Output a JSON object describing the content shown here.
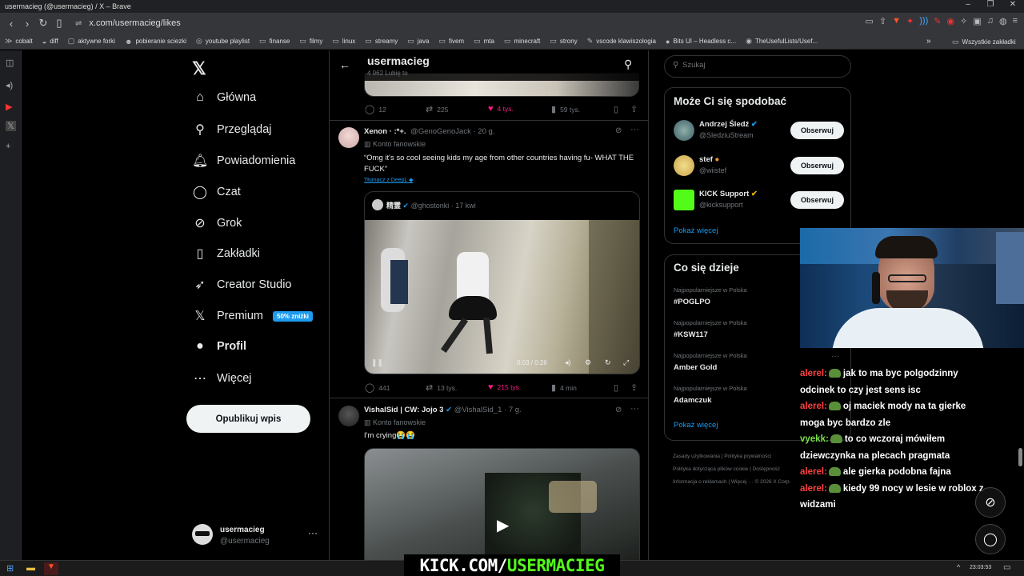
{
  "browser": {
    "window_title": "usermacieg (@usermacieg) / X – Brave",
    "url": "x.com/usermacieg/likes",
    "bookmarks": [
      "cobalt",
      "diff",
      "aktywne forki",
      "pobieranie sciezki",
      "youtube playlist",
      "finanse",
      "filmy",
      "linux",
      "streamy",
      "java",
      "fivem",
      "mta",
      "minecraft",
      "strony",
      "vscode klawiszologia",
      "Bits UI – Headless c...",
      "TheUsefulLists/Usef..."
    ],
    "bookmarks_more": "»",
    "all_bookmarks": "Wszystkie zakładki"
  },
  "nav": {
    "items": [
      {
        "label": "Główna",
        "icon": "home-icon",
        "glyph": "⌂"
      },
      {
        "label": "Przeglądaj",
        "icon": "search-icon",
        "glyph": "⚲"
      },
      {
        "label": "Powiadomienia",
        "icon": "bell-icon",
        "glyph": "🔔︎"
      },
      {
        "label": "Czat",
        "icon": "chat-icon",
        "glyph": "◯"
      },
      {
        "label": "Grok",
        "icon": "grok-icon",
        "glyph": "⊘"
      },
      {
        "label": "Zakładki",
        "icon": "bookmark-icon",
        "glyph": "▯"
      },
      {
        "label": "Creator Studio",
        "icon": "rocket-icon",
        "glyph": "➶"
      },
      {
        "label": "Premium",
        "icon": "x-logo-icon",
        "glyph": "𝕏"
      },
      {
        "label": "Profil",
        "icon": "person-icon",
        "glyph": "●"
      },
      {
        "label": "Więcej",
        "icon": "more-icon",
        "glyph": "⋯"
      }
    ],
    "premium_badge": "50% zniżki",
    "post_button": "Opublikuj wpis",
    "account": {
      "name": "usermacieg",
      "handle": "@usermacieg"
    }
  },
  "header": {
    "title": "usermacieg",
    "subtitle": "4 962 Lubię to"
  },
  "tweets": [
    {
      "stats": {
        "reply": "12",
        "retweet": "225",
        "like": "4 tys.",
        "views": "59 tys."
      }
    },
    {
      "author": "Xenon · :*+.",
      "handle": "@GenoGenoJack",
      "time": "20 g.",
      "fan_label": "Konto fanowskie",
      "text": "“Omg it's so cool seeing kids my age from other countries having fu- WHAT THE FUCK”",
      "translate": "Tłumacz z DeepL",
      "quote": {
        "author": "精霊",
        "handle": "@ghostonki",
        "time": "17 kwi",
        "video_time": "0:03 / 0:26"
      },
      "stats": {
        "reply": "441",
        "retweet": "13 tys.",
        "like": "215 tys.",
        "views": "4 min"
      }
    },
    {
      "author": "VishalSid | CW: Jojo 3",
      "handle": "@VishalSid_1",
      "time": "7 g.",
      "fan_label": "Konto fanowskie",
      "text": "I'm crying😭😭"
    }
  ],
  "search": {
    "placeholder": "Szukaj"
  },
  "suggestions": {
    "title": "Może Ci się spodobać",
    "items": [
      {
        "name": "Andrzej Śledź",
        "handle": "@SledziuStream",
        "button": "Obserwuj"
      },
      {
        "name": "stef",
        "handle": "@wiistef",
        "button": "Obserwuj"
      },
      {
        "name": "KICK Support",
        "handle": "@kicksupport",
        "button": "Obserwuj"
      }
    ],
    "more": "Pokaż więcej"
  },
  "trends": {
    "title": "Co się dzieje",
    "items": [
      {
        "category": "Najpopularniejsze w Polska",
        "name": "#POGLPO"
      },
      {
        "category": "Najpopularniejsze w Polska",
        "name": "#KSW117"
      },
      {
        "category": "Najpopularniejsze w Polska",
        "name": "Amber Gold"
      },
      {
        "category": "Najpopularniejsze w Polska",
        "name": "Adamczuk"
      }
    ],
    "more": "Pokaż więcej"
  },
  "footer": {
    "links": [
      "Zasady użytkowania",
      "Polityka prywatności",
      "Polityka dotycząca plików cookie",
      "Dostępność",
      "Informacja o reklamach",
      "Więcej ···"
    ],
    "copyright": "© 2026 X Corp."
  },
  "chat": [
    {
      "user": "alerel:",
      "color": "#ff4040",
      "text": "jak to ma byc polgodzinny odcinek to czy jest sens isc"
    },
    {
      "user": "alerel:",
      "color": "#ff4040",
      "text": "oj maciek mody na ta gierke moga byc bardzo zle"
    },
    {
      "user": "vyekk:",
      "color": "#7be04a",
      "text": "to co wczoraj mówiłem dziewczynka na plecach pragmata"
    },
    {
      "user": "alerel:",
      "color": "#ff4040",
      "text": "ale gierka podobna fajna"
    },
    {
      "user": "alerel:",
      "color": "#ff4040",
      "text": "kiedy 99 nocy w lesie w roblox z widzami"
    }
  ],
  "overlay": {
    "kick_prefix": "KICK.COM/",
    "kick_user": "USERMACIEG",
    "kick_color": "#53fc18"
  },
  "taskbar": {
    "time": "23:03:53"
  }
}
